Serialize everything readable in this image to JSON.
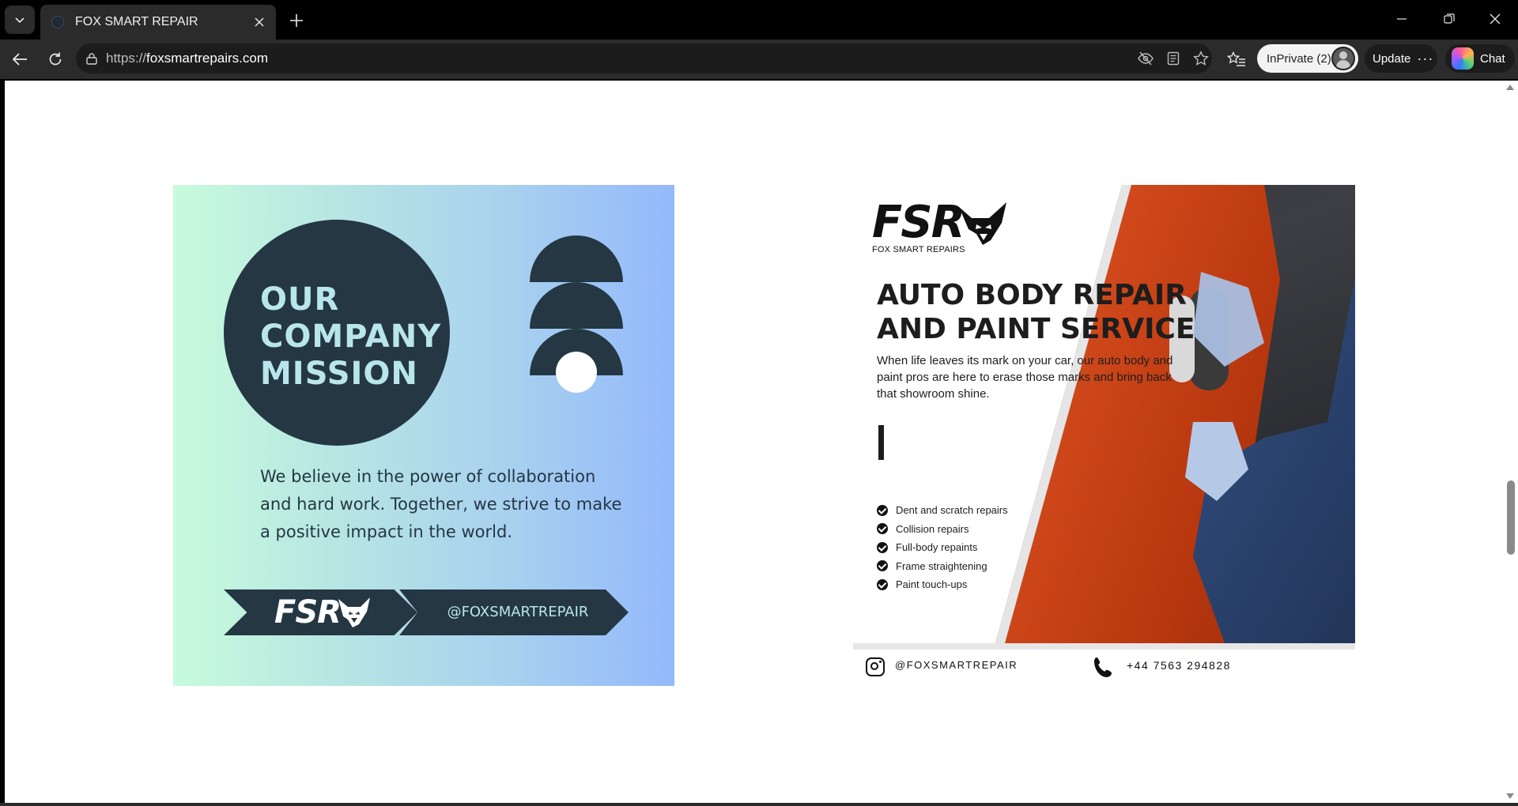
{
  "browser": {
    "tab_title": "FOX SMART REPAIR",
    "url_prefix": "https://",
    "url_host": "foxsmartrepairs.com",
    "inprivate_label": "InPrivate (2)",
    "update_label": "Update",
    "update_dots": "···",
    "chat_label": "Chat"
  },
  "mission": {
    "title_lines": [
      "OUR",
      "COMPANY",
      "MISSION"
    ],
    "body": "We believe in the power of collaboration and hard work. Together, we strive to make a positive impact in the world.",
    "logo_text": "FSR",
    "handle": "@FOXSMARTREPAIR",
    "colors": {
      "dark": "#243743",
      "accent": "#b8e6ea",
      "gradient_start": "#c7fbdc",
      "gradient_end": "#94b9fb"
    }
  },
  "flyer": {
    "logo_text": "FSR",
    "logo_sub": "FOX SMART REPAIRS",
    "title_lines": [
      "AUTO BODY REPAIR",
      "AND PAINT SERVICE"
    ],
    "description": "When life leaves its mark on your car, our auto body and paint pros are here to erase those marks and bring back that showroom shine.",
    "services": [
      "Dent and scratch repairs",
      "Collision repairs",
      "Full-body repaints",
      "Frame straightening",
      "Paint touch-ups"
    ],
    "footer_handle": "@FOXSMARTREPAIR",
    "footer_phone": "+44 7563 294828"
  }
}
